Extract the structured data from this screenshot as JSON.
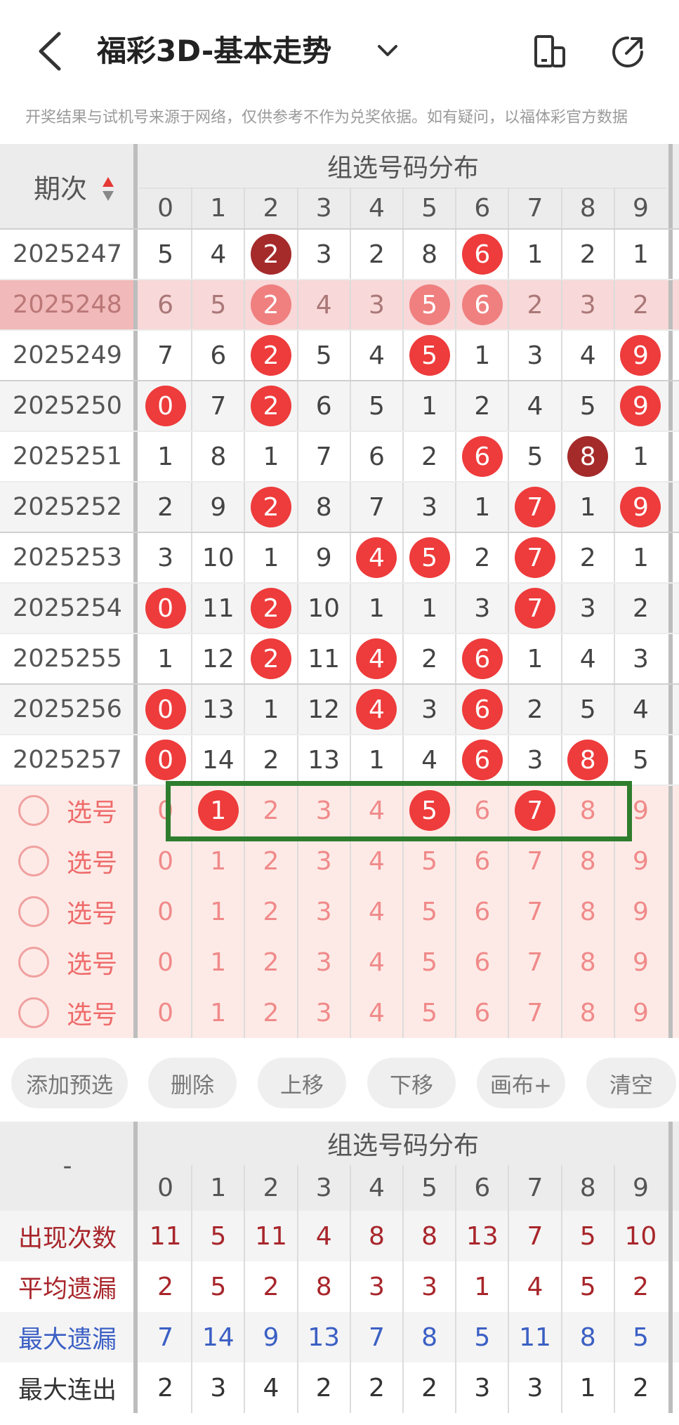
{
  "header": {
    "title": "福彩3D-基本走势",
    "notice": "开奖结果与试机号来源于网络，仅供参考不作为兑奖依据。如有疑问，以福体彩官方数据"
  },
  "table": {
    "period_header": "期次",
    "group_title": "组选号码分布",
    "digits": [
      "0",
      "1",
      "2",
      "3",
      "4",
      "5",
      "6",
      "7",
      "8",
      "9"
    ],
    "rows": [
      {
        "period": "2025247",
        "values": [
          "5",
          "4",
          "2",
          "3",
          "2",
          "8",
          "6",
          "1",
          "2",
          "1"
        ],
        "balls": [
          2,
          6
        ],
        "dark": [
          2
        ]
      },
      {
        "period": "2025248",
        "values": [
          "6",
          "5",
          "2",
          "4",
          "3",
          "5",
          "6",
          "2",
          "3",
          "2"
        ],
        "balls": [
          2,
          5,
          6
        ],
        "dark": []
      },
      {
        "period": "2025249",
        "values": [
          "7",
          "6",
          "2",
          "5",
          "4",
          "5",
          "1",
          "3",
          "4",
          "9"
        ],
        "balls": [
          2,
          5,
          9
        ],
        "dark": []
      },
      {
        "period": "2025250",
        "values": [
          "0",
          "7",
          "2",
          "6",
          "5",
          "1",
          "2",
          "4",
          "5",
          "9"
        ],
        "balls": [
          0,
          2,
          9
        ],
        "dark": []
      },
      {
        "period": "2025251",
        "values": [
          "1",
          "8",
          "1",
          "7",
          "6",
          "2",
          "6",
          "5",
          "8",
          "1"
        ],
        "balls": [
          6,
          8
        ],
        "dark": [
          8
        ]
      },
      {
        "period": "2025252",
        "values": [
          "2",
          "9",
          "2",
          "8",
          "7",
          "3",
          "1",
          "7",
          "1",
          "9"
        ],
        "balls": [
          2,
          7,
          9
        ],
        "dark": []
      },
      {
        "period": "2025253",
        "values": [
          "3",
          "10",
          "1",
          "9",
          "4",
          "5",
          "2",
          "7",
          "2",
          "1"
        ],
        "balls": [
          4,
          5,
          7
        ],
        "dark": []
      },
      {
        "period": "2025254",
        "values": [
          "0",
          "11",
          "2",
          "10",
          "1",
          "1",
          "3",
          "7",
          "3",
          "2"
        ],
        "balls": [
          0,
          2,
          7
        ],
        "dark": []
      },
      {
        "period": "2025255",
        "values": [
          "1",
          "12",
          "2",
          "11",
          "4",
          "2",
          "6",
          "1",
          "4",
          "3"
        ],
        "balls": [
          2,
          4,
          6
        ],
        "dark": []
      },
      {
        "period": "2025256",
        "values": [
          "0",
          "13",
          "1",
          "12",
          "4",
          "3",
          "6",
          "2",
          "5",
          "4"
        ],
        "balls": [
          0,
          4,
          6
        ],
        "dark": []
      },
      {
        "period": "2025257",
        "values": [
          "0",
          "14",
          "2",
          "13",
          "1",
          "4",
          "6",
          "3",
          "8",
          "5"
        ],
        "balls": [
          0,
          6,
          8
        ],
        "dark": []
      }
    ],
    "pick_label": "选号",
    "pick_rows": 5,
    "pick_selected": [
      1,
      5,
      7
    ]
  },
  "buttons": [
    "添加预选",
    "删除",
    "上移",
    "下移",
    "画布+",
    "清空"
  ],
  "stats": {
    "corner": "-",
    "group_title": "组选号码分布",
    "rows": [
      {
        "label": "出现次数",
        "values": [
          "11",
          "5",
          "11",
          "4",
          "8",
          "8",
          "13",
          "7",
          "5",
          "10"
        ],
        "color": "#a8262b"
      },
      {
        "label": "平均遗漏",
        "values": [
          "2",
          "5",
          "2",
          "8",
          "3",
          "3",
          "1",
          "4",
          "5",
          "2"
        ],
        "color": "#a8262b"
      },
      {
        "label": "最大遗漏",
        "values": [
          "7",
          "14",
          "9",
          "13",
          "7",
          "8",
          "5",
          "11",
          "8",
          "5"
        ],
        "color": "#3b5fc4"
      },
      {
        "label": "最大连出",
        "values": [
          "2",
          "3",
          "4",
          "2",
          "2",
          "2",
          "3",
          "3",
          "1",
          "2"
        ],
        "color": "#333333"
      }
    ]
  },
  "colors": {
    "ball": "#ee3b3b",
    "ball_dark": "#a52a2a",
    "highlight": "#2e7d2e"
  }
}
